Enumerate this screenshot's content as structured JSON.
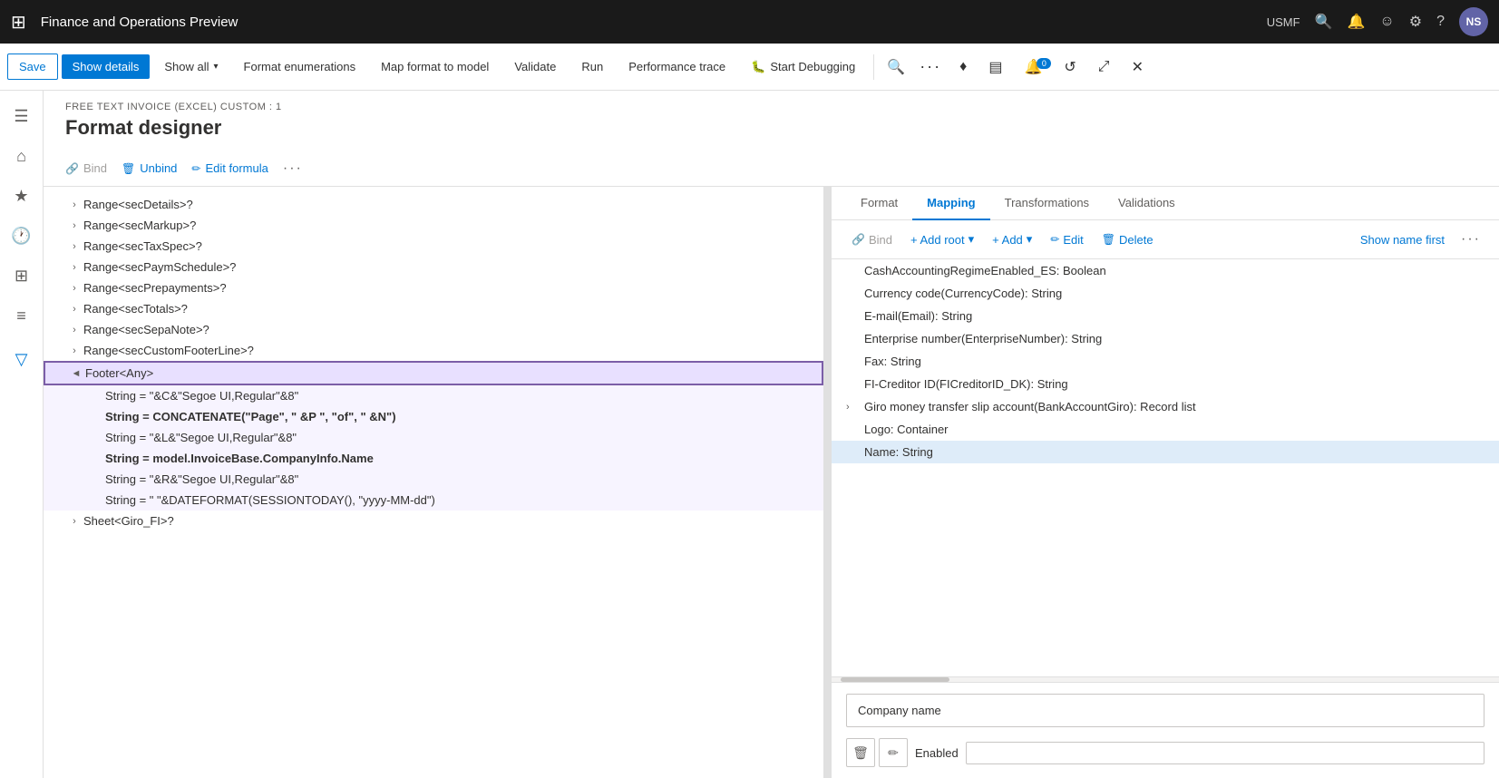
{
  "topbar": {
    "title": "Finance and Operations Preview",
    "username": "USMF",
    "avatar": "NS"
  },
  "toolbar": {
    "save_label": "Save",
    "show_details_label": "Show details",
    "show_all_label": "Show all",
    "format_enumerations_label": "Format enumerations",
    "map_format_label": "Map format to model",
    "validate_label": "Validate",
    "run_label": "Run",
    "performance_trace_label": "Performance trace",
    "start_debugging_label": "Start Debugging",
    "notification_count": "0"
  },
  "page": {
    "breadcrumb": "FREE TEXT INVOICE (EXCEL) CUSTOM : 1",
    "title": "Format designer"
  },
  "action_bar": {
    "bind_label": "Bind",
    "unbind_label": "Unbind",
    "edit_formula_label": "Edit formula"
  },
  "tree_items": [
    {
      "indent": 1,
      "caret": "›",
      "label": "Range<secDetails>?",
      "bold": false
    },
    {
      "indent": 1,
      "caret": "›",
      "label": "Range<secMarkup>?",
      "bold": false
    },
    {
      "indent": 1,
      "caret": "›",
      "label": "Range<secTaxSpec>?",
      "bold": false
    },
    {
      "indent": 1,
      "caret": "›",
      "label": "Range<secPaymSchedule>?",
      "bold": false
    },
    {
      "indent": 1,
      "caret": "›",
      "label": "Range<secPrepayments>?",
      "bold": false
    },
    {
      "indent": 1,
      "caret": "›",
      "label": "Range<secTotals>?",
      "bold": false
    },
    {
      "indent": 1,
      "caret": "›",
      "label": "Range<secSepaNote>?",
      "bold": false
    },
    {
      "indent": 1,
      "caret": "›",
      "label": "Range<secCustomFooterLine>?",
      "bold": false
    },
    {
      "indent": 1,
      "caret": "◄",
      "label": "Footer<Any>",
      "bold": false,
      "group_selected": true
    },
    {
      "indent": 2,
      "caret": "",
      "label": "String = \"&C&\"Segoe UI,Regular\"&8\"",
      "bold": false,
      "group_child": true
    },
    {
      "indent": 2,
      "caret": "",
      "label": "String = CONCATENATE(\"Page\", \" &P \", \"of\", \" &N\")",
      "bold": true,
      "group_child": true
    },
    {
      "indent": 2,
      "caret": "",
      "label": "String = \"&L&\"Segoe UI,Regular\"&8\"",
      "bold": false,
      "group_child": true
    },
    {
      "indent": 2,
      "caret": "",
      "label": "String = model.InvoiceBase.CompanyInfo.Name",
      "bold": true,
      "group_child": true
    },
    {
      "indent": 2,
      "caret": "",
      "label": "String = \"&R&\"Segoe UI,Regular\"&8\"",
      "bold": false,
      "group_child": true
    },
    {
      "indent": 2,
      "caret": "",
      "label": "String = \" \"&DATEFORMAT(SESSIONTODAY(), \"yyyy-MM-dd\")",
      "bold": false,
      "group_child": true
    },
    {
      "indent": 1,
      "caret": "›",
      "label": "Sheet<Giro_FI>?",
      "bold": false
    }
  ],
  "tabs": [
    {
      "label": "Format",
      "active": false
    },
    {
      "label": "Mapping",
      "active": true
    },
    {
      "label": "Transformations",
      "active": false
    },
    {
      "label": "Validations",
      "active": false
    }
  ],
  "right_actions": {
    "bind_label": "Bind",
    "add_root_label": "+ Add root",
    "add_label": "+ Add",
    "edit_label": "Edit",
    "delete_label": "Delete",
    "show_name_first_label": "Show name first"
  },
  "mapping_items": [
    {
      "indent": 0,
      "caret": "",
      "label": "CashAccountingRegimeEnabled_ES: Boolean",
      "selected": false
    },
    {
      "indent": 0,
      "caret": "",
      "label": "Currency code(CurrencyCode): String",
      "selected": false
    },
    {
      "indent": 0,
      "caret": "",
      "label": "E-mail(Email): String",
      "selected": false
    },
    {
      "indent": 0,
      "caret": "",
      "label": "Enterprise number(EnterpriseNumber): String",
      "selected": false
    },
    {
      "indent": 0,
      "caret": "",
      "label": "Fax: String",
      "selected": false
    },
    {
      "indent": 0,
      "caret": "",
      "label": "FI-Creditor ID(FICreditorID_DK): String",
      "selected": false
    },
    {
      "indent": 0,
      "caret": "›",
      "label": "Giro money transfer slip account(BankAccountGiro): Record list",
      "selected": false
    },
    {
      "indent": 0,
      "caret": "",
      "label": "Logo: Container",
      "selected": false
    },
    {
      "indent": 0,
      "caret": "",
      "label": "Name: String",
      "selected": true
    }
  ],
  "bottom": {
    "company_name_label": "Company name",
    "enabled_label": "Enabled"
  }
}
